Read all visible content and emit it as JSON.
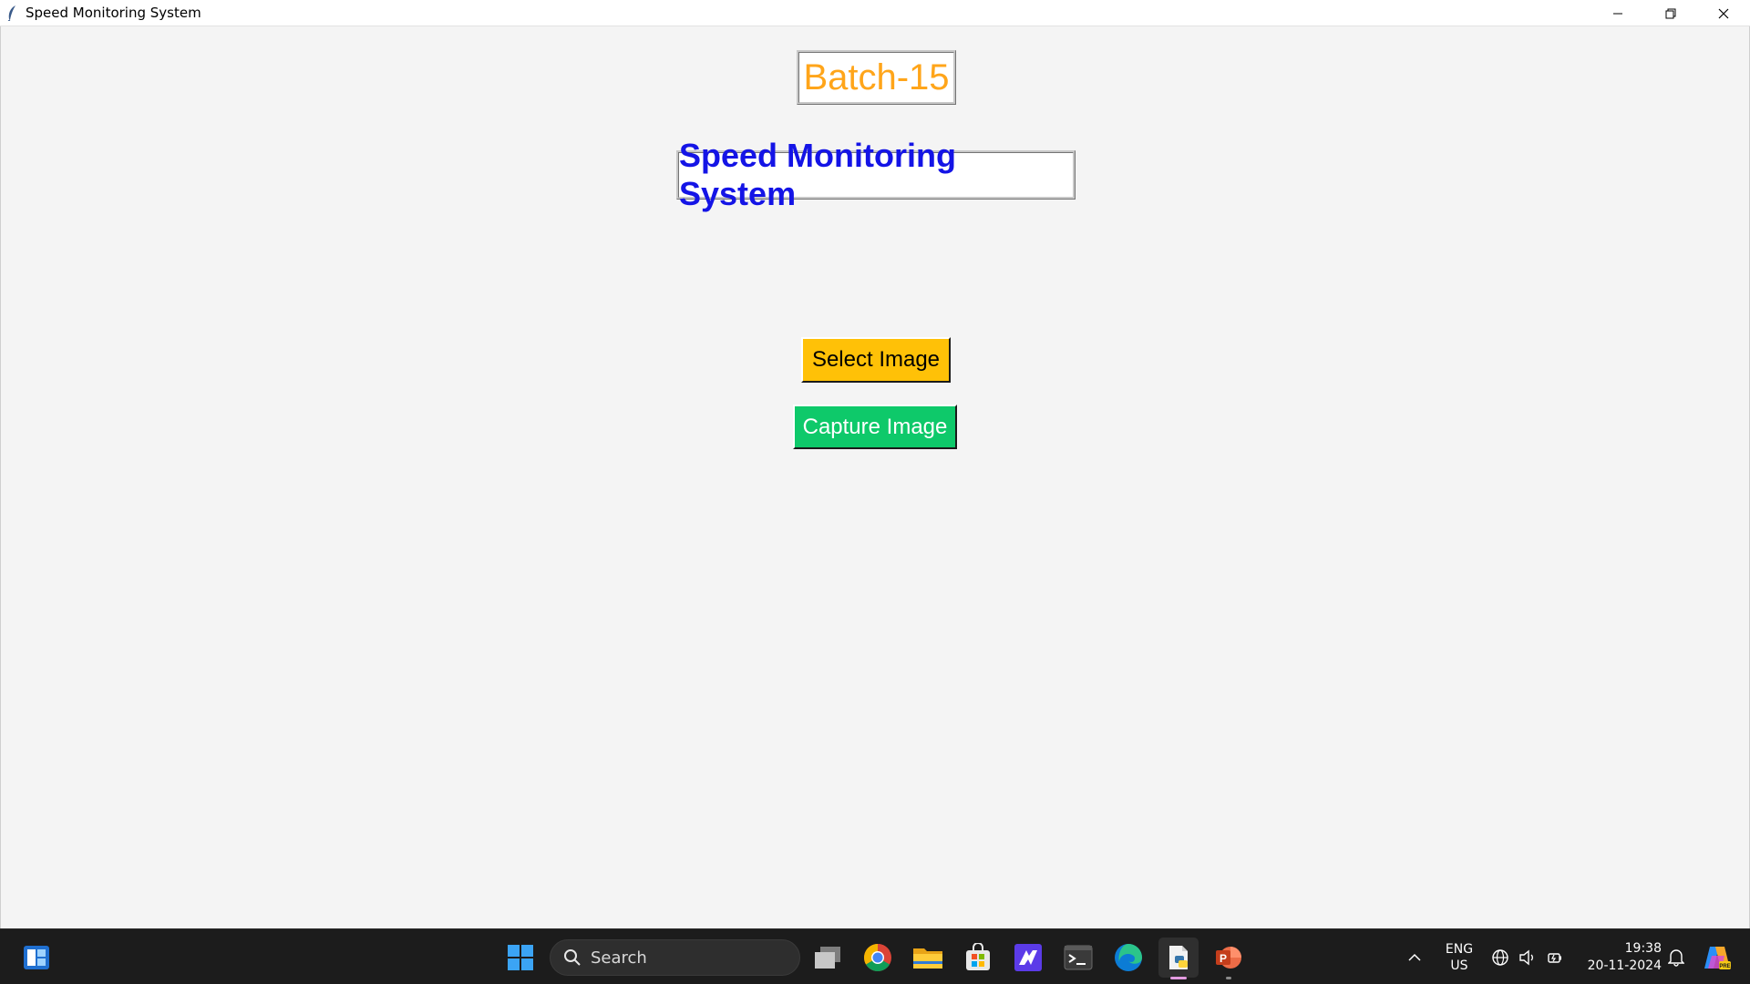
{
  "window": {
    "title": "Speed Monitoring System",
    "controls": [
      "minimize",
      "restore",
      "close"
    ]
  },
  "app": {
    "batch_label": "Batch-15",
    "system_label": "Speed Monitoring System",
    "select_button": "Select Image",
    "capture_button": "Capture Image"
  },
  "colors": {
    "batch_text": "#ffa51a",
    "system_text": "#1414e6",
    "select_bg": "#ffc107",
    "capture_bg": "#0ec96a",
    "capture_text": "#ffffff",
    "taskbar_bg": "#1c1c1c"
  },
  "taskbar": {
    "search_placeholder": "Search",
    "apps": [
      {
        "name": "task-view-icon",
        "running": false
      },
      {
        "name": "chrome-icon",
        "running": false
      },
      {
        "name": "file-explorer-icon",
        "running": false
      },
      {
        "name": "microsoft-store-icon",
        "running": false
      },
      {
        "name": "visual-studio-icon",
        "running": false
      },
      {
        "name": "terminal-icon",
        "running": false
      },
      {
        "name": "edge-icon",
        "running": false
      },
      {
        "name": "python-idle-icon",
        "running": true,
        "active": true
      },
      {
        "name": "powerpoint-icon",
        "running": true
      }
    ],
    "lang_line1": "ENG",
    "lang_line2": "US",
    "time": "19:38",
    "date": "20-11-2024"
  }
}
